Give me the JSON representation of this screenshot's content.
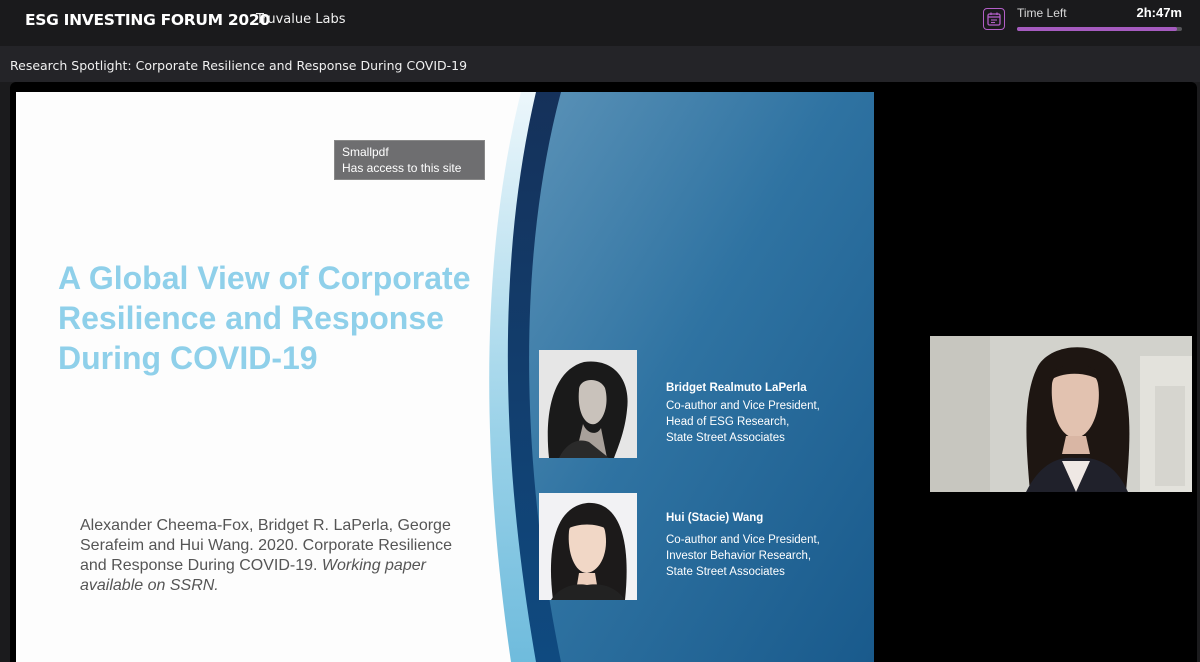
{
  "header": {
    "event_title": "ESG INVESTING FORUM 2020",
    "organizer": "Truvalue Labs",
    "time_left_label": "Time Left",
    "time_left_value": "2h:47m",
    "time_progress": 0.97,
    "accent_color": "#a55bbf"
  },
  "session": {
    "title": "Research Spotlight: Corporate Resilience and Response During COVID-19"
  },
  "slide": {
    "title_lines": [
      "A Global View of Corporate",
      "Resilience and Response",
      "During COVID-19"
    ],
    "citation_text": "Alexander Cheema-Fox, Bridget R. LaPerla, George Serafeim and Hui Wang. 2020. Corporate Resilience and Response During COVID-19.",
    "citation_emphasis": "Working paper available on SSRN.",
    "title_color": "#8fd0ea",
    "authors": [
      {
        "name": "Bridget Realmuto LaPerla",
        "role_lines": [
          "Co-author and Vice President,",
          "Head of ESG Research,",
          "State Street Associates"
        ]
      },
      {
        "name": "Hui (Stacie) Wang",
        "role_lines": [
          "Co-author and Vice President,",
          "Investor Behavior Research,",
          "State Street Associates"
        ]
      }
    ]
  },
  "tooltip": {
    "line1": "Smallpdf",
    "line2": "Has access to this site"
  },
  "icons": {
    "calendar": "calendar-icon"
  }
}
